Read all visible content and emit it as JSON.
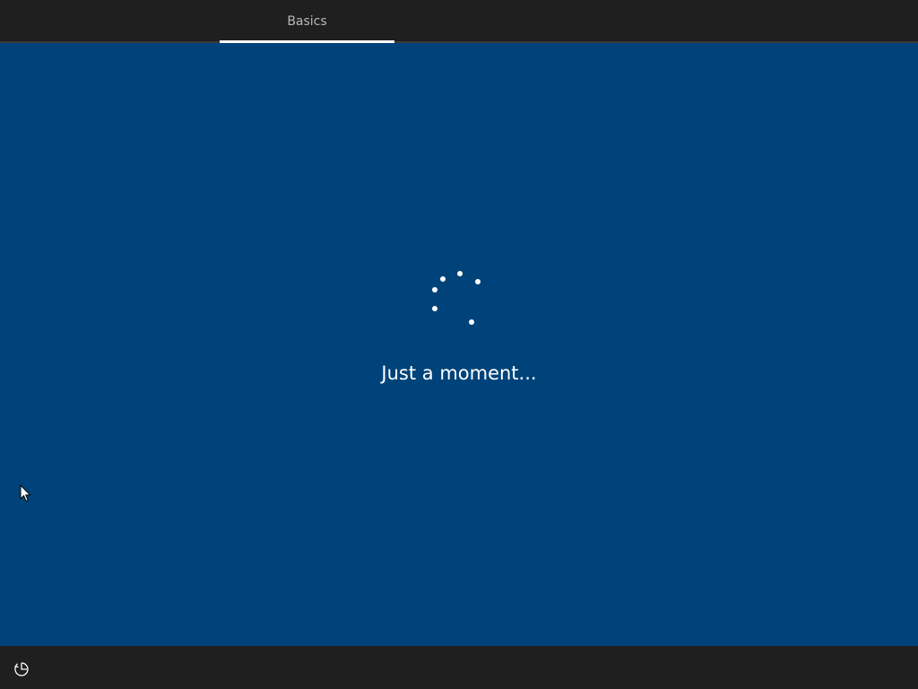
{
  "header": {
    "tabs": [
      {
        "label": "Basics",
        "active": true
      }
    ]
  },
  "main": {
    "status_text": "Just a moment...",
    "spinner_icon": "loading-spinner-icon"
  },
  "footer": {
    "ease_of_access_icon": "ease-of-access-icon"
  },
  "colors": {
    "background": "#00437a",
    "bar": "#1f1f1f",
    "text": "#ffffff",
    "tab_text": "#b8b8b8"
  }
}
